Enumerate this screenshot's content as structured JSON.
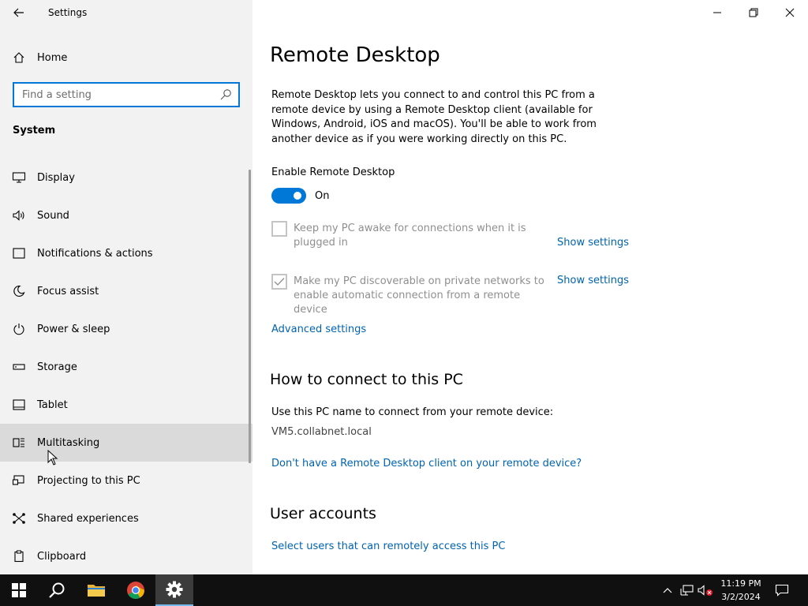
{
  "app": {
    "title": "Settings"
  },
  "sidebar": {
    "home_label": "Home",
    "search_placeholder": "Find a setting",
    "section": "System",
    "items": [
      {
        "label": "Display",
        "icon": "monitor-icon"
      },
      {
        "label": "Sound",
        "icon": "speaker-icon"
      },
      {
        "label": "Notifications & actions",
        "icon": "notification-icon"
      },
      {
        "label": "Focus assist",
        "icon": "moon-icon"
      },
      {
        "label": "Power & sleep",
        "icon": "power-icon"
      },
      {
        "label": "Storage",
        "icon": "storage-icon"
      },
      {
        "label": "Tablet",
        "icon": "tablet-icon"
      },
      {
        "label": "Multitasking",
        "icon": "multitasking-icon"
      },
      {
        "label": "Projecting to this PC",
        "icon": "projecting-icon"
      },
      {
        "label": "Shared experiences",
        "icon": "shared-icon"
      },
      {
        "label": "Clipboard",
        "icon": "clipboard-icon"
      }
    ]
  },
  "main": {
    "title": "Remote Desktop",
    "description": "Remote Desktop lets you connect to and control this PC from a remote device by using a Remote Desktop client (available for Windows, Android, iOS and macOS). You'll be able to work from another device as if you were working directly on this PC.",
    "enable_label": "Enable Remote Desktop",
    "toggle_state": "On",
    "checkbox1": {
      "line1": "Keep my PC awake for connections when it is",
      "line2": "plugged in",
      "link": "Show settings",
      "checked": false
    },
    "checkbox2": {
      "line1": "Make my PC discoverable on private networks to",
      "line2": "enable automatic connection from a remote device",
      "link": "Show settings",
      "checked": true
    },
    "advanced_link": "Advanced settings",
    "connect_heading": "How to connect to this PC",
    "connect_text": "Use this PC name to connect from your remote device:",
    "pc_name": "VM5.collabnet.local",
    "client_link": "Don't have a Remote Desktop client on your remote device?",
    "accounts_heading": "User accounts",
    "accounts_link": "Select users that can remotely access this PC"
  },
  "taskbar": {
    "time": "11:19 PM",
    "date": "3/2/2024"
  },
  "colors": {
    "accent": "#0078d7",
    "link": "#0063b1",
    "sidebar_bg": "#f2f2f2",
    "taskbar_bg": "#101010"
  }
}
